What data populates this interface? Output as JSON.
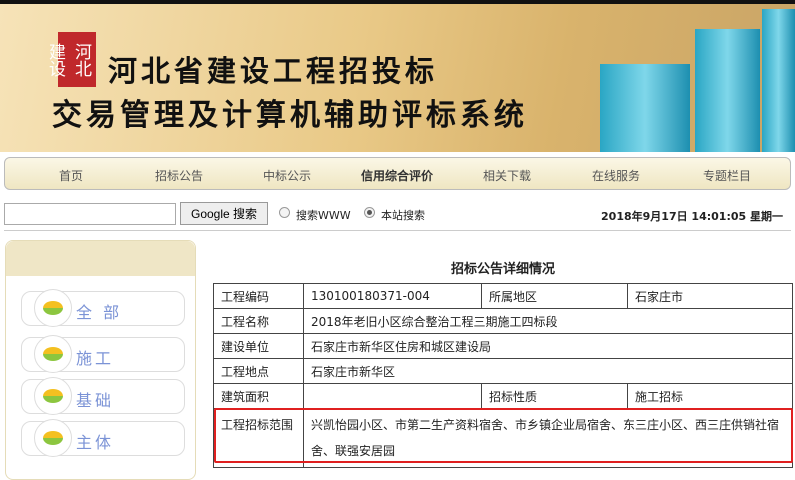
{
  "header": {
    "title_line1": "河北省建设工程招投标",
    "title_line2": "交易管理及计算机辅助评标系统",
    "seal_text": "河北建设"
  },
  "nav": {
    "items": [
      "首页",
      "招标公告",
      "中标公示",
      "信用综合评价",
      "相关下载",
      "在线服务",
      "专题栏目"
    ]
  },
  "search": {
    "input_value": "",
    "button_label": "Google 搜索",
    "radio_www": "搜索WWW",
    "radio_site": "本站搜索",
    "selected": "本站搜索"
  },
  "datetime": "2018年9月17日 14:01:05 星期一",
  "sidebar": {
    "items": [
      "全 部",
      "施工",
      "基础",
      "主体"
    ]
  },
  "detail": {
    "title": "招标公告详细情况",
    "rows": [
      {
        "label": "工程编码",
        "value": "130100180371-004",
        "label2": "所属地区",
        "value2": "石家庄市"
      },
      {
        "label": "工程名称",
        "value": "2018年老旧小区综合整治工程三期施工四标段"
      },
      {
        "label": "建设单位",
        "value": "石家庄市新华区住房和城区建设局"
      },
      {
        "label": "工程地点",
        "value": "石家庄市新华区"
      },
      {
        "label": "建筑面积",
        "value": "",
        "label2": "招标性质",
        "value2": "施工招标"
      },
      {
        "label": "工程招标范围",
        "value": "兴凯怡园小区、市第二生产资料宿舍、市乡镇企业局宿舍、东三庄小区、西三庄供销社宿舍、联强安居园"
      }
    ]
  },
  "colors": {
    "highlight": "#e02020",
    "nav_bg": "#efe6c2",
    "sidebar_text": "#7b93d6"
  }
}
